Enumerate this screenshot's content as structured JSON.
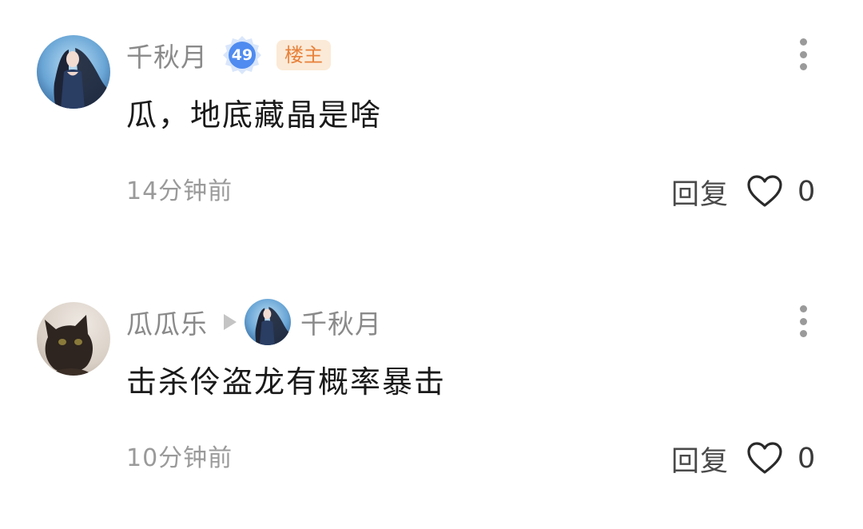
{
  "comments": [
    {
      "username": "千秋月",
      "level": "49",
      "op_tag": "楼主",
      "content": "瓜，地底藏晶是啥",
      "time": "14分钟前",
      "reply_label": "回复",
      "likes": "0",
      "avatar_icon": "avatar-fantasy-woman"
    },
    {
      "username": "瓜瓜乐",
      "reply_to": "千秋月",
      "content": "击杀伶盗龙有概率暴击",
      "time": "10分钟前",
      "reply_label": "回复",
      "likes": "0",
      "avatar_icon": "avatar-cat"
    }
  ],
  "colors": {
    "username": "#8a8a8a",
    "op_tag_bg": "#fbead7",
    "op_tag_text": "#e8813b",
    "level_badge": "#4f8bf0",
    "content": "#1a1a1a",
    "meta": "#9a9a9a"
  }
}
